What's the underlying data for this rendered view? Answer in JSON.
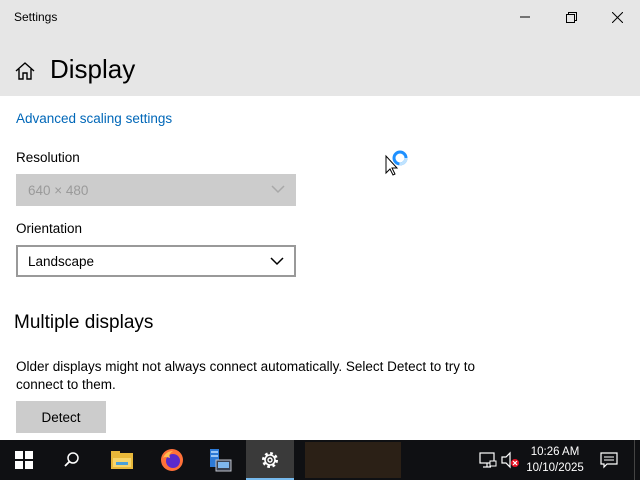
{
  "window": {
    "title": "Settings"
  },
  "header": {
    "title": "Display"
  },
  "content": {
    "advanced_link": "Advanced scaling settings",
    "resolution": {
      "label": "Resolution",
      "value": "640 × 480"
    },
    "orientation": {
      "label": "Orientation",
      "value": "Landscape"
    },
    "multiple_displays": {
      "title": "Multiple displays",
      "description": "Older displays might not always connect automatically. Select Detect to try to connect to them.",
      "detect_label": "Detect"
    }
  },
  "taskbar": {
    "items": [
      "windows-start-icon",
      "search-icon",
      "file-explorer-icon",
      "firefox-icon",
      "server-manager-icon",
      "settings-gear-icon"
    ],
    "time": "10:26 AM",
    "date": "10/10/2025"
  },
  "colors": {
    "link": "#0067b8",
    "header_bg": "#e6e6e6",
    "taskbar_bg": "#0f1013",
    "accent": "#76b9ed"
  }
}
